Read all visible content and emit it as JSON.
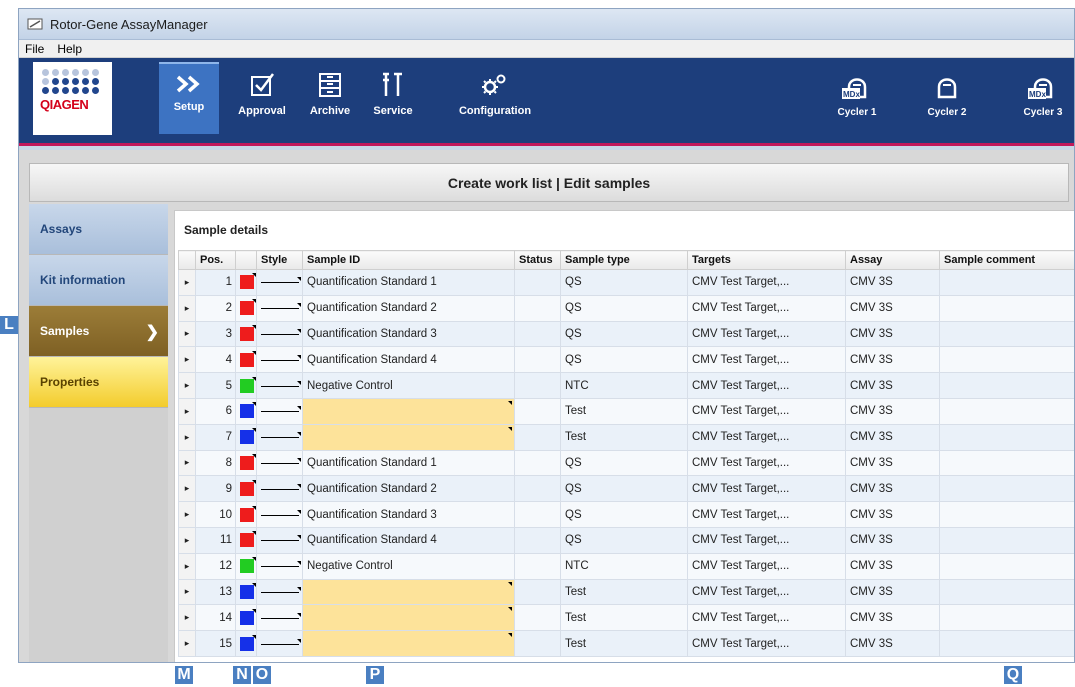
{
  "window": {
    "title": "Rotor-Gene AssayManager"
  },
  "menu": {
    "items": [
      "File",
      "Help"
    ]
  },
  "logo": {
    "brand": "QIAGEN"
  },
  "nav": {
    "setup": "Setup",
    "approval": "Approval",
    "archive": "Archive",
    "service": "Service",
    "configuration": "Configuration"
  },
  "cyclers": [
    {
      "label": "Cycler 1",
      "badge": "MDx"
    },
    {
      "label": "Cycler 2",
      "badge": ""
    },
    {
      "label": "Cycler 3",
      "badge": "MDx"
    }
  ],
  "page": {
    "header": "Create work list | Edit samples"
  },
  "sidebar": {
    "items": [
      {
        "label": "Assays"
      },
      {
        "label": "Kit information"
      },
      {
        "label": "Samples",
        "active": true
      },
      {
        "label": "Properties"
      }
    ]
  },
  "panel": {
    "title": "Sample details"
  },
  "table": {
    "columns": [
      "Pos.",
      "Style",
      "Sample ID",
      "Status",
      "Sample type",
      "Targets",
      "Assay",
      "Sample comment"
    ],
    "rows": [
      {
        "pos": "1",
        "color": "#ee1c1c",
        "sample_id": "Quantification Standard 1",
        "status": "",
        "type": "QS",
        "targets": "CMV Test Target,...",
        "assay": "CMV 3S",
        "comment": ""
      },
      {
        "pos": "2",
        "color": "#ee1c1c",
        "sample_id": "Quantification Standard 2",
        "status": "",
        "type": "QS",
        "targets": "CMV Test Target,...",
        "assay": "CMV 3S",
        "comment": ""
      },
      {
        "pos": "3",
        "color": "#ee1c1c",
        "sample_id": "Quantification Standard 3",
        "status": "",
        "type": "QS",
        "targets": "CMV Test Target,...",
        "assay": "CMV 3S",
        "comment": ""
      },
      {
        "pos": "4",
        "color": "#ee1c1c",
        "sample_id": "Quantification Standard 4",
        "status": "",
        "type": "QS",
        "targets": "CMV Test Target,...",
        "assay": "CMV 3S",
        "comment": ""
      },
      {
        "pos": "5",
        "color": "#22cc22",
        "sample_id": "Negative Control",
        "status": "",
        "type": "NTC",
        "targets": "CMV Test Target,...",
        "assay": "CMV 3S",
        "comment": ""
      },
      {
        "pos": "6",
        "color": "#1530e8",
        "sample_id": "",
        "status": "",
        "type": "Test",
        "targets": "CMV Test Target,...",
        "assay": "CMV 3S",
        "comment": ""
      },
      {
        "pos": "7",
        "color": "#1530e8",
        "sample_id": "",
        "status": "",
        "type": "Test",
        "targets": "CMV Test Target,...",
        "assay": "CMV 3S",
        "comment": ""
      },
      {
        "pos": "8",
        "color": "#ee1c1c",
        "sample_id": "Quantification Standard 1",
        "status": "",
        "type": "QS",
        "targets": "CMV Test Target,...",
        "assay": "CMV 3S",
        "comment": ""
      },
      {
        "pos": "9",
        "color": "#ee1c1c",
        "sample_id": "Quantification Standard 2",
        "status": "",
        "type": "QS",
        "targets": "CMV Test Target,...",
        "assay": "CMV 3S",
        "comment": ""
      },
      {
        "pos": "10",
        "color": "#ee1c1c",
        "sample_id": "Quantification Standard 3",
        "status": "",
        "type": "QS",
        "targets": "CMV Test Target,...",
        "assay": "CMV 3S",
        "comment": ""
      },
      {
        "pos": "11",
        "color": "#ee1c1c",
        "sample_id": "Quantification Standard 4",
        "status": "",
        "type": "QS",
        "targets": "CMV Test Target,...",
        "assay": "CMV 3S",
        "comment": ""
      },
      {
        "pos": "12",
        "color": "#22cc22",
        "sample_id": "Negative Control",
        "status": "",
        "type": "NTC",
        "targets": "CMV Test Target,...",
        "assay": "CMV 3S",
        "comment": ""
      },
      {
        "pos": "13",
        "color": "#1530e8",
        "sample_id": "",
        "status": "",
        "type": "Test",
        "targets": "CMV Test Target,...",
        "assay": "CMV 3S",
        "comment": ""
      },
      {
        "pos": "14",
        "color": "#1530e8",
        "sample_id": "",
        "status": "",
        "type": "Test",
        "targets": "CMV Test Target,...",
        "assay": "CMV 3S",
        "comment": ""
      },
      {
        "pos": "15",
        "color": "#1530e8",
        "sample_id": "",
        "status": "",
        "type": "Test",
        "targets": "CMV Test Target,...",
        "assay": "CMV 3S",
        "comment": ""
      }
    ]
  },
  "callouts": {
    "l": "L",
    "m": "M",
    "n": "N",
    "o": "O",
    "p": "P",
    "q": "Q"
  }
}
